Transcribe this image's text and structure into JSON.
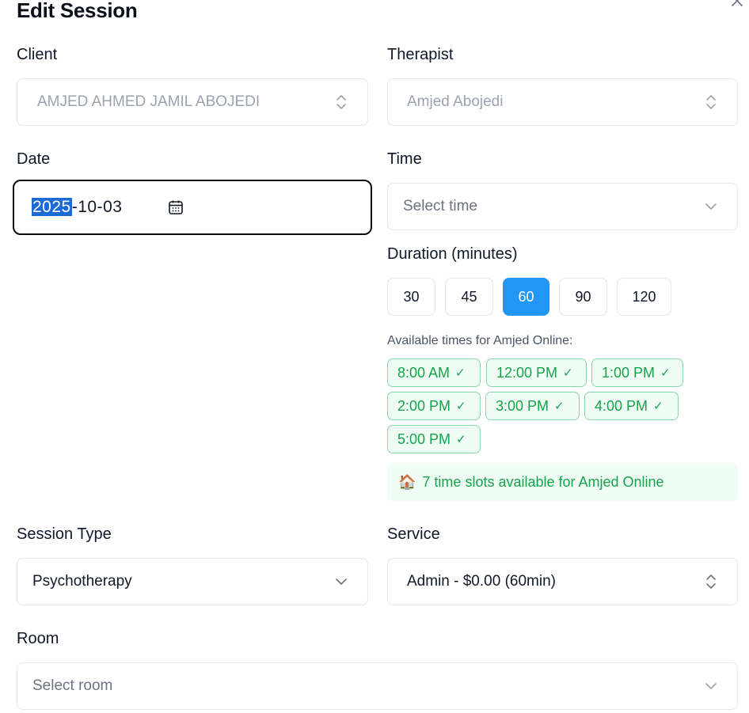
{
  "dialog": {
    "title": "Edit Session",
    "close_icon": "close-icon"
  },
  "client": {
    "label": "Client",
    "value": "AMJED AHMED JAMIL ABOJEDI"
  },
  "therapist": {
    "label": "Therapist",
    "value": "Amjed Abojedi"
  },
  "date": {
    "label": "Date",
    "year": "2025",
    "rest": "-10-03",
    "icon": "calendar-icon"
  },
  "time": {
    "label": "Time",
    "placeholder": "Select time"
  },
  "duration": {
    "label": "Duration (minutes)",
    "options": [
      "30",
      "45",
      "60",
      "90",
      "120"
    ],
    "selected": "60"
  },
  "availability": {
    "label": "Available times for Amjed Online:",
    "slots": [
      "8:00 AM",
      "12:00 PM",
      "1:00 PM",
      "2:00 PM",
      "3:00 PM",
      "4:00 PM",
      "5:00 PM"
    ],
    "summary_icon": "🏠",
    "summary": "7 time slots available for Amjed Online",
    "colors": {
      "text": "#16a34a",
      "border": "#86d7a4",
      "bg": "#f0fdf4"
    }
  },
  "session_type": {
    "label": "Session Type",
    "value": "Psychotherapy"
  },
  "service": {
    "label": "Service",
    "value": "Admin - $0.00 (60min)"
  },
  "room": {
    "label": "Room",
    "placeholder": "Select room"
  },
  "colors": {
    "accent": "#2196f3",
    "selection": "#1d6ad6"
  }
}
